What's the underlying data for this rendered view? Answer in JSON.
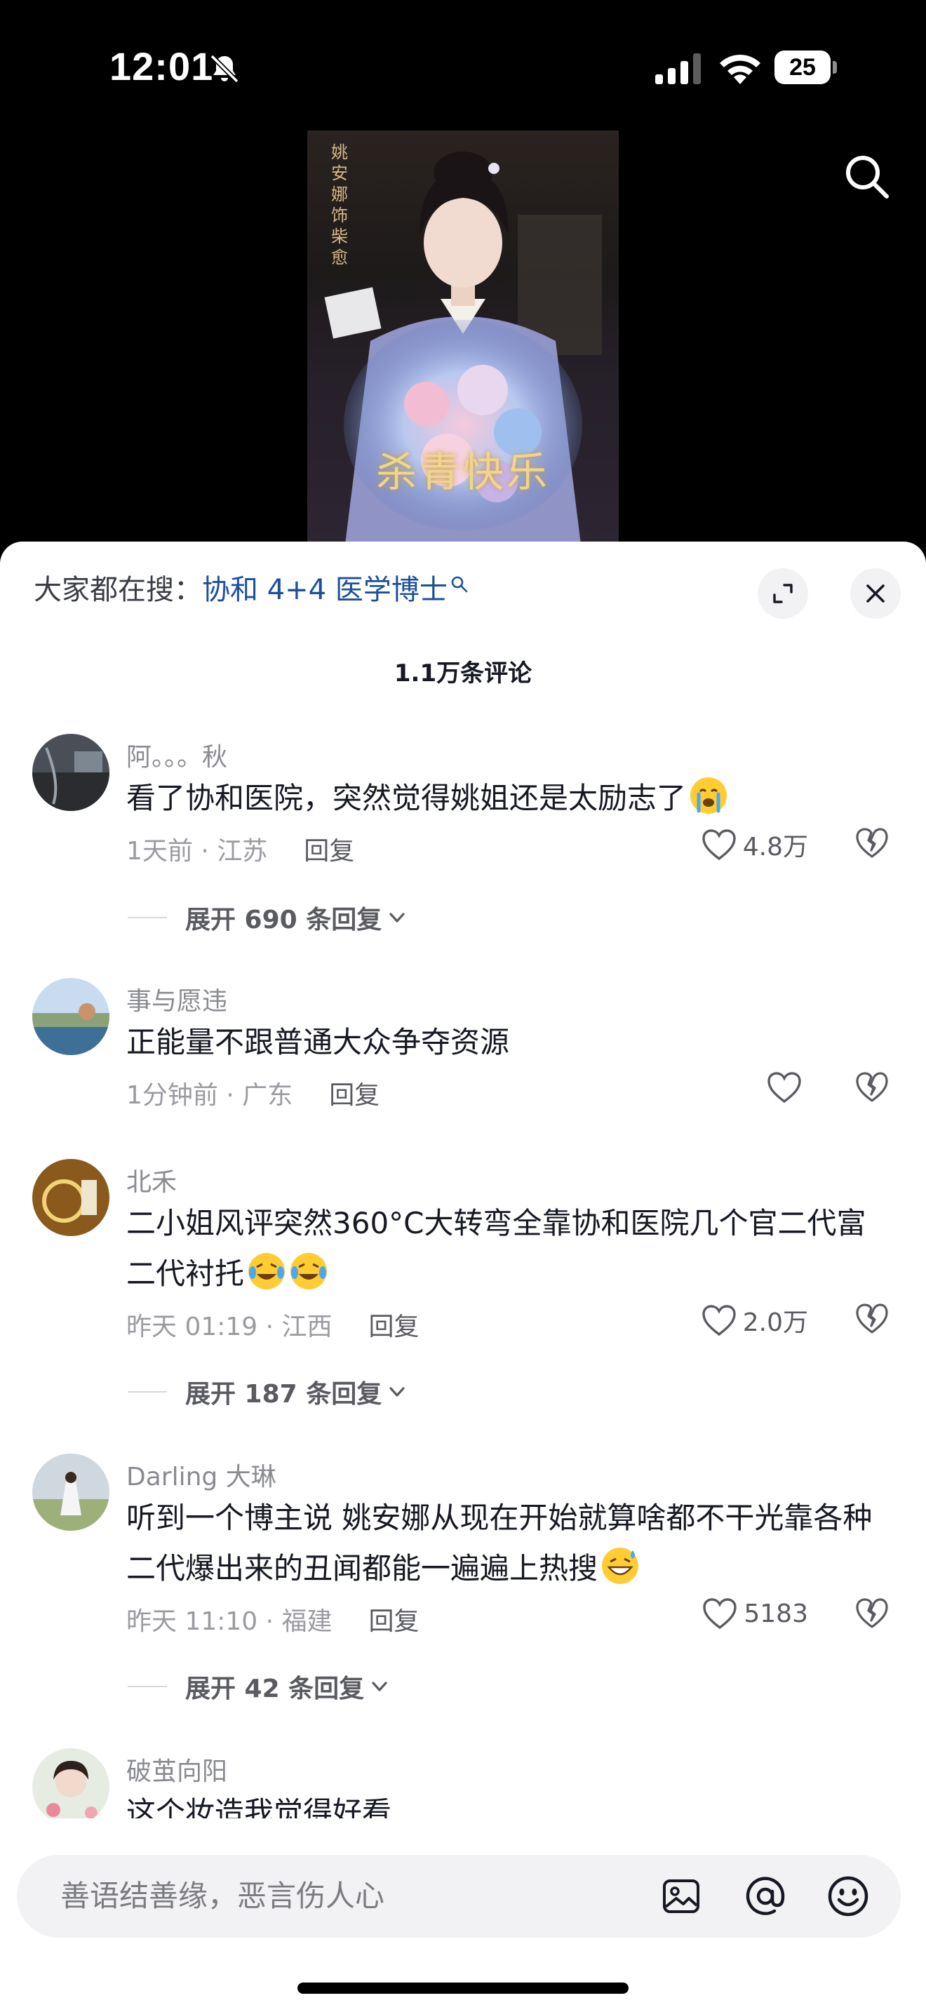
{
  "status_bar": {
    "time": "12:01",
    "battery_level": "25",
    "icons": [
      "mute-icon",
      "cellular-signal-icon",
      "wifi-icon",
      "battery-icon"
    ]
  },
  "video": {
    "vertical_text": "姚安娜饰柴愈",
    "caption": "杀青快乐",
    "search_icon": "search-icon"
  },
  "sheet": {
    "hot_search_label": "大家都在搜：",
    "hot_search_term": "协和 4+4 医学博士",
    "comments_count": "1.1万条评论",
    "expand_icon": "expand-icon",
    "close_icon": "close-icon"
  },
  "comments": [
    {
      "username": "阿。。。秋",
      "text": "看了协和医院，突然觉得姚姐还是太励志了",
      "emoji": "crying-emoji",
      "meta": "1天前 · 江苏",
      "reply": "回复",
      "likes": "4.8万",
      "expand": "展开 690 条回复"
    },
    {
      "username": "事与愿违",
      "text": "正能量不跟普通大众争夺资源",
      "meta": "1分钟前 · 广东",
      "reply": "回复",
      "likes": ""
    },
    {
      "username": "北禾",
      "text": "二小姐风评突然360°C大转弯全靠协和医院几个官二代富二代衬托",
      "emoji": "laughing-tears-emoji",
      "meta": "昨天 01:19 · 江西",
      "reply": "回复",
      "likes": "2.0万",
      "expand": "展开 187 条回复"
    },
    {
      "username": "Darling 大琳",
      "text": "听到一个博主说  姚安娜从现在开始就算啥都不干光靠各种二代爆出来的丑闻都能一遍遍上热搜",
      "emoji": "grin-sweat-emoji",
      "meta": "昨天 11:10 · 福建",
      "reply": "回复",
      "likes": "5183",
      "expand": "展开 42 条回复"
    },
    {
      "username": "破茧向阳",
      "text": "这个妆造我觉得好看"
    }
  ],
  "input": {
    "placeholder": "善语结善缘，恶言伤人心",
    "icons": [
      "image-icon",
      "at-mention-icon",
      "emoji-icon"
    ]
  },
  "colors": {
    "link_blue": "#1b4f9c",
    "text_primary": "#161823",
    "text_secondary": "#9a9ba1",
    "sheet_bg": "#ffffff",
    "input_bg": "#f2f2f4"
  }
}
